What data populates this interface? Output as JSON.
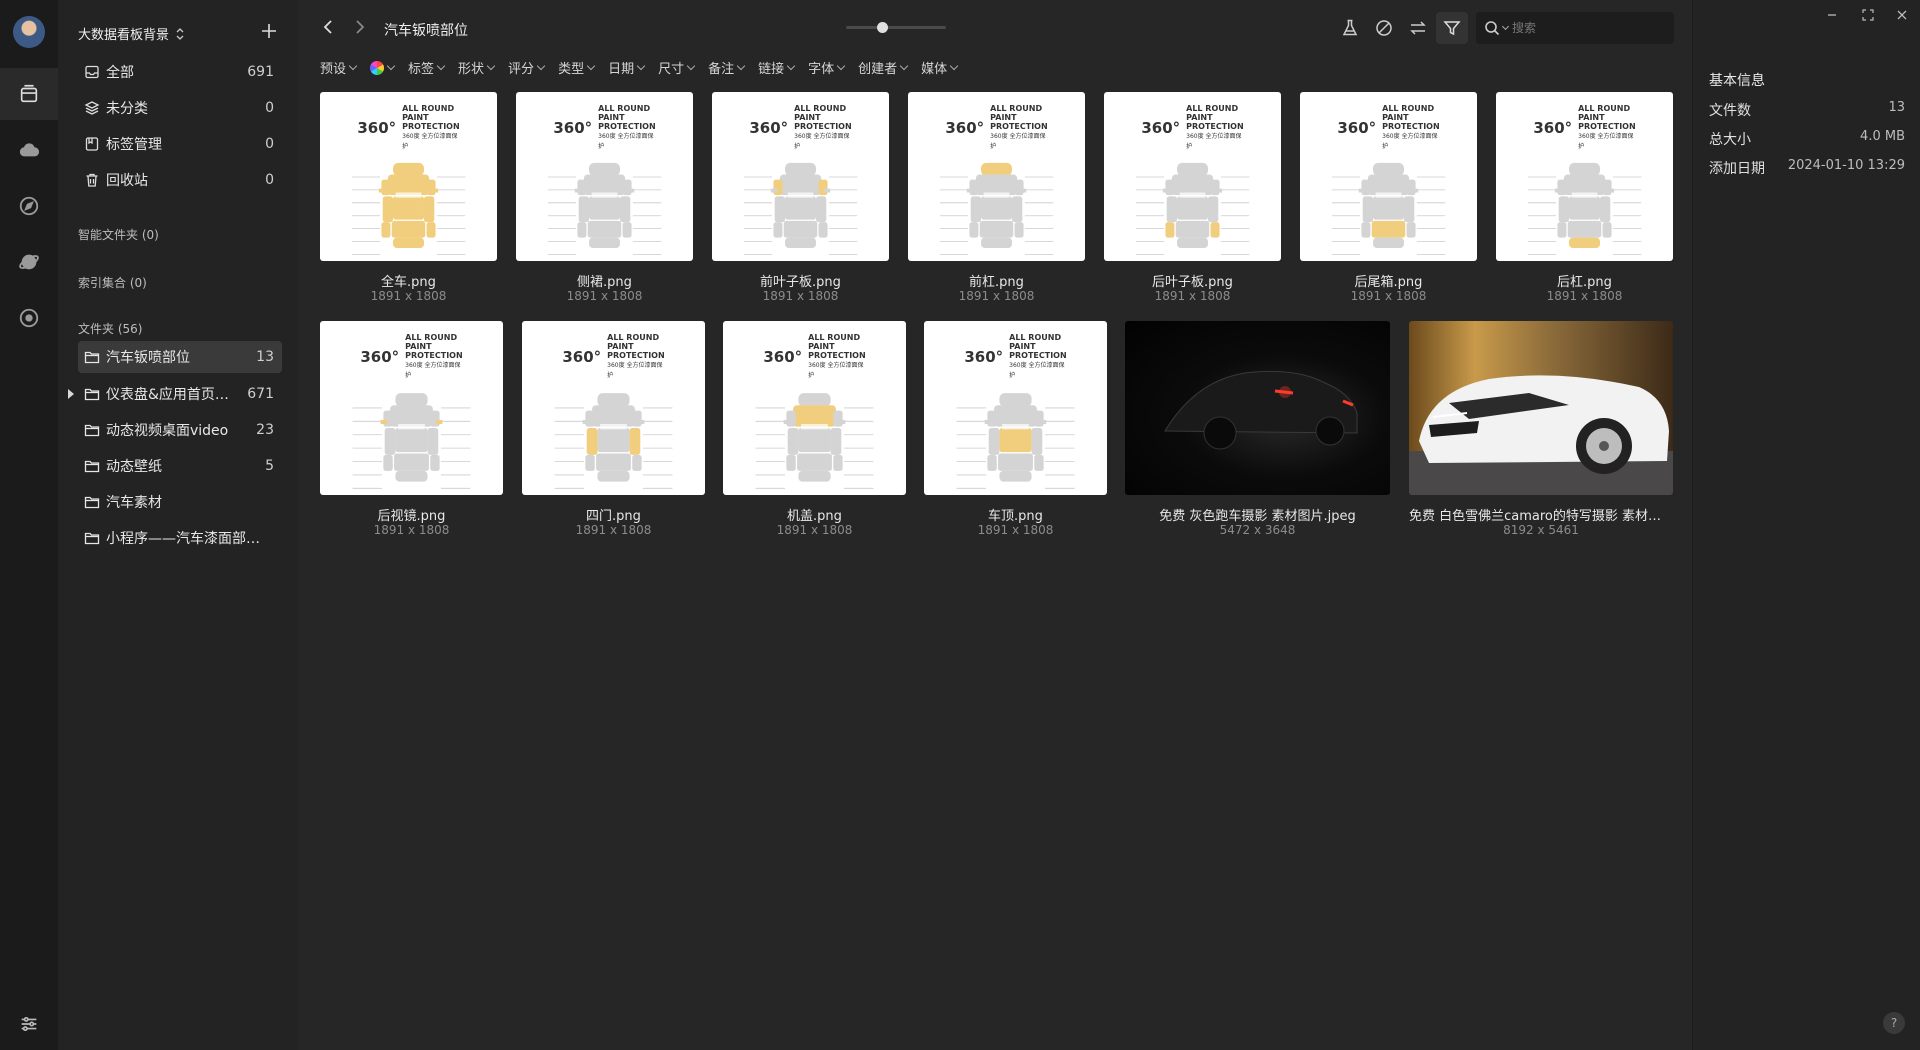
{
  "library": {
    "title": "大数据看板背景",
    "add_label": "+"
  },
  "nav": {
    "all": {
      "label": "全部",
      "count": "691"
    },
    "uncategorized": {
      "label": "未分类",
      "count": "0"
    },
    "tags": {
      "label": "标签管理",
      "count": "0"
    },
    "trash": {
      "label": "回收站",
      "count": "0"
    }
  },
  "sections": {
    "smart": "智能文件夹 (0)",
    "index": "索引集合 (0)",
    "folders": "文件夹 (56)"
  },
  "folders": [
    {
      "label": "汽车钣喷部位",
      "count": "13"
    },
    {
      "label": "仪表盘&应用首页精...",
      "count": "671"
    },
    {
      "label": "动态视频桌面video",
      "count": "23"
    },
    {
      "label": "动态壁纸",
      "count": "5"
    },
    {
      "label": "汽车素材",
      "count": ""
    },
    {
      "label": "小程序——汽车漆面部位...",
      "count": ""
    }
  ],
  "toolbar": {
    "folder_title": "汽车钣喷部位",
    "search_placeholder": "搜索",
    "zoom_level": 0.36
  },
  "filters": [
    "预设",
    "标签",
    "形状",
    "评分",
    "类型",
    "日期",
    "尺寸",
    "备注",
    "链接",
    "字体",
    "创建者",
    "媒体"
  ],
  "thumb_logo": {
    "big": "360°",
    "line1": "ALL ROUND PAINT",
    "line2": "PROTECTION",
    "line3": "360度 全方位漆面保护"
  },
  "items": [
    {
      "name": "全车.png",
      "size": "1891 x 1808",
      "kind": "diagram",
      "highlight": "full"
    },
    {
      "name": "侧裙.png",
      "size": "1891 x 1808",
      "kind": "diagram",
      "highlight": "none"
    },
    {
      "name": "前叶子板.png",
      "size": "1891 x 1808",
      "kind": "diagram",
      "highlight": "front-fender"
    },
    {
      "name": "前杠.png",
      "size": "1891 x 1808",
      "kind": "diagram",
      "highlight": "front-bumper"
    },
    {
      "name": "后叶子板.png",
      "size": "1891 x 1808",
      "kind": "diagram",
      "highlight": "rear-fender"
    },
    {
      "name": "后尾箱.png",
      "size": "1891 x 1808",
      "kind": "diagram",
      "highlight": "trunk"
    },
    {
      "name": "后杠.png",
      "size": "1891 x 1808",
      "kind": "diagram",
      "highlight": "rear-bumper"
    },
    {
      "name": "后视镜.png",
      "size": "1891 x 1808",
      "kind": "diagram",
      "highlight": "mirror"
    },
    {
      "name": "四门.png",
      "size": "1891 x 1808",
      "kind": "diagram",
      "highlight": "doors"
    },
    {
      "name": "机盖.png",
      "size": "1891 x 1808",
      "kind": "diagram",
      "highlight": "hood"
    },
    {
      "name": "车顶.png",
      "size": "1891 x 1808",
      "kind": "diagram",
      "highlight": "roof"
    },
    {
      "name": "免费 灰色跑车摄影 素材图片.jpeg",
      "size": "5472 x 3648",
      "kind": "photo-dark"
    },
    {
      "name": "免费 白色雪佛兰camaro的特写摄影 素材图片.jp...",
      "size": "8192 x 5461",
      "kind": "photo-white"
    }
  ],
  "info": {
    "title": "基本信息",
    "rows": [
      {
        "key": "文件数",
        "value": "13"
      },
      {
        "key": "总大小",
        "value": "4.0 MB"
      },
      {
        "key": "添加日期",
        "value": "2024-01-10 13:29"
      }
    ],
    "help": "?"
  },
  "colors": {
    "accent_yellow": "#f1ce7d",
    "car_gray": "#d4d4d4",
    "bg_main": "#262626",
    "bg_sidebar": "#232323",
    "bg_rail": "#1b1b1b"
  }
}
